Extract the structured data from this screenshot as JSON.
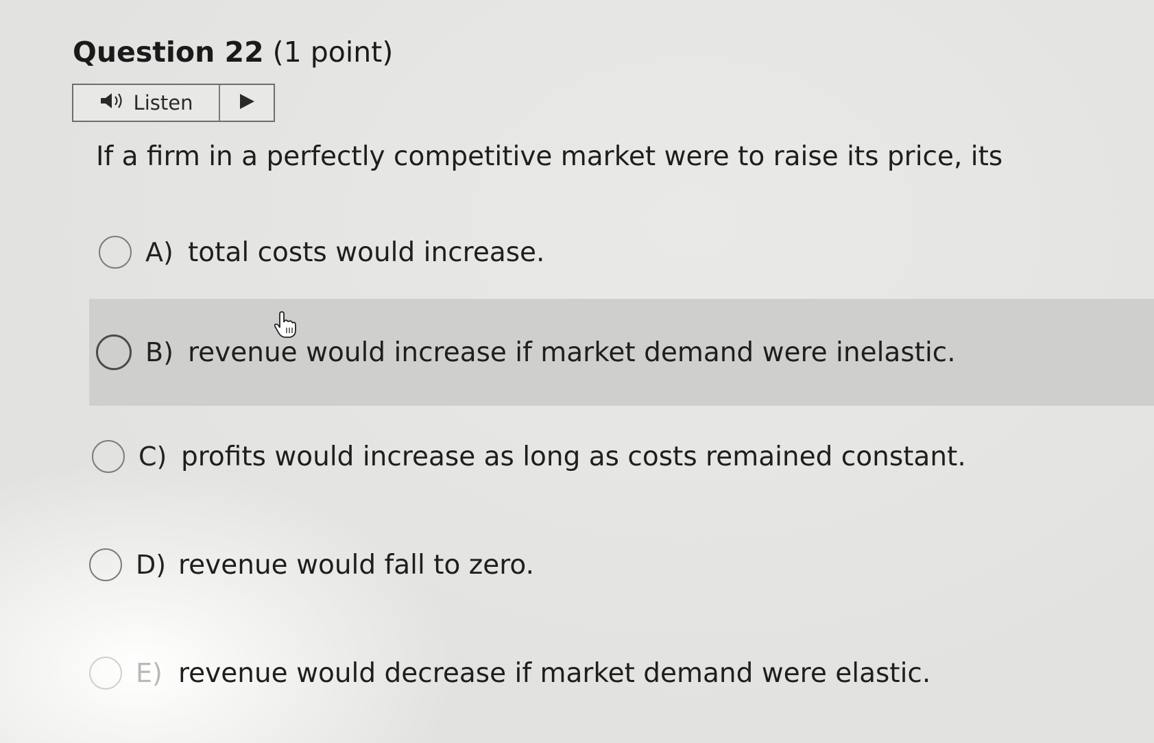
{
  "question": {
    "number_label": "Question 22",
    "points_label": "(1 point)",
    "text": "If a firm in a perfectly competitive market were to raise its price, its"
  },
  "listen": {
    "label": "Listen",
    "speaker_icon": "speaker-icon",
    "play_icon": "play-icon"
  },
  "options": [
    {
      "letter": "A)",
      "text": "total costs would increase."
    },
    {
      "letter": "B)",
      "text": "revenue would increase if market demand were inelastic."
    },
    {
      "letter": "C)",
      "text": "profits would increase as long as costs remained constant."
    },
    {
      "letter": "D)",
      "text": "revenue would fall to zero."
    },
    {
      "letter": "E)",
      "text": "revenue would decrease if market demand were elastic."
    }
  ],
  "colors": {
    "hover_row": "#cfcfcd",
    "page_bg": "#e4e4e2"
  }
}
